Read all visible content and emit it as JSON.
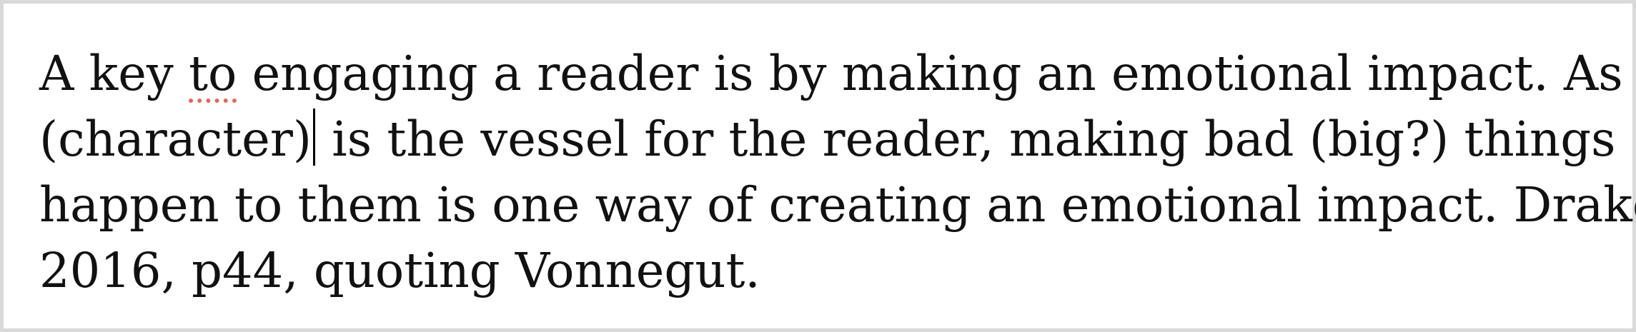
{
  "document": {
    "lines": [
      {
        "before": "A key ",
        "flagged": "to",
        "after": " engaging a reader is by making an emotional impact. As the"
      },
      {
        "before_caret": "(character)",
        "after_caret": " is the vessel for the reader, making bad (big?) things"
      },
      {
        "text": "happen to them is one way of creating an emotional impact. Drake"
      },
      {
        "text": "2016, p44, quoting Vonnegut."
      }
    ]
  },
  "colors": {
    "spellcheck_underline": "#e0685f",
    "caret": "#000000",
    "text": "#111111",
    "background": "#ffffff",
    "border": "#d9d9d9"
  }
}
